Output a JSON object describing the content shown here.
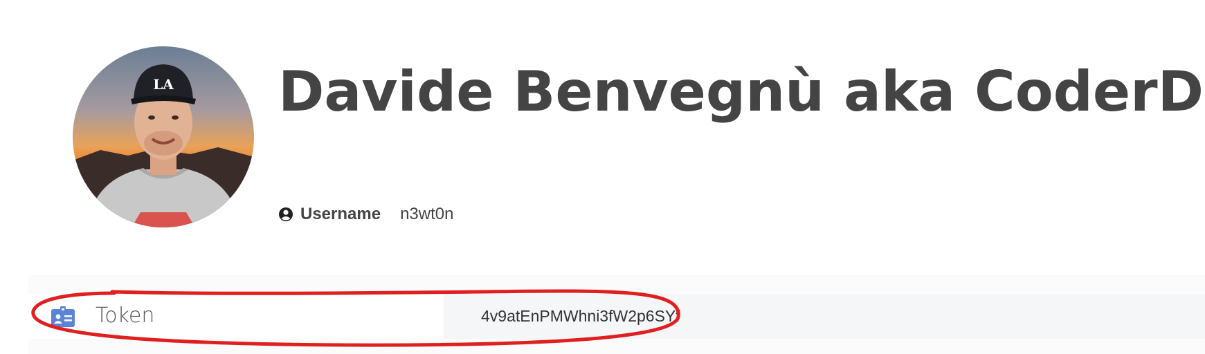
{
  "profile": {
    "name": "Davide Benvegnù aka CoderDave",
    "avatar_icon": "profile-photo",
    "cap_logo": "LA"
  },
  "username": {
    "icon": "user-circle-icon",
    "label": "Username",
    "value": "n3wt0n"
  },
  "token": {
    "icon": "id-badge-icon",
    "label": "Token",
    "value": "4v9atEnPMWhni3fW2p6SYf"
  },
  "colors": {
    "text": "#444444",
    "icon_blue": "#5b84d6",
    "annotation_red": "#e02020",
    "value_cell_bg": "#f5f6f8"
  }
}
